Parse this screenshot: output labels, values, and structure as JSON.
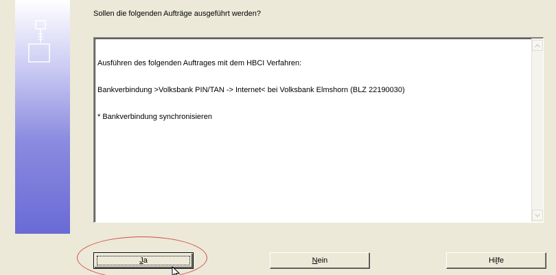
{
  "dialog": {
    "question": "Sollen die folgenden Aufträge ausgeführt werden?",
    "text_lines": [
      "Ausführen des folgenden Auftrages mit dem HBCI Verfahren:",
      "Bankverbindung >Volksbank PIN/TAN -> Internet< bei Volksbank Elmshorn (BLZ 22190030)",
      "* Bankverbindung synchronisieren"
    ]
  },
  "buttons": {
    "yes_prefix": "",
    "yes_mnemonic": "J",
    "yes_rest": "a",
    "no_mnemonic": "N",
    "no_rest": "ein",
    "help_prefix": "Hi",
    "help_mnemonic": "l",
    "help_rest": "fe"
  },
  "colors": {
    "dialog_bg": "#ece9d8",
    "highlight": "#d44a4a",
    "strip_top": "#ffffff",
    "strip_bottom": "#6a6ad6"
  },
  "icons": {
    "side": "flowchart-icon",
    "cursor": "mouse-pointer-icon"
  }
}
